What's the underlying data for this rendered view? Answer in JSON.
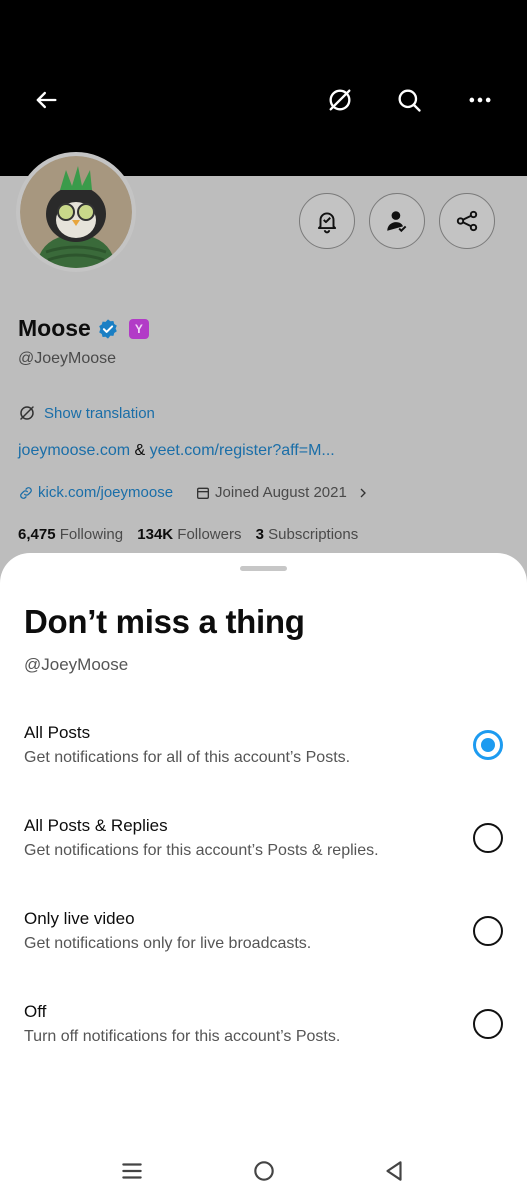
{
  "header": {
    "back_icon": "arrow-left-icon",
    "translate_icon": "translate-off-icon",
    "search_icon": "search-icon",
    "more_icon": "more-dots-icon"
  },
  "profile": {
    "name": "Moose",
    "badge_letter": "Y",
    "handle": "@JoeyMoose",
    "show_translation": "Show translation",
    "link1": "joeymoose.com",
    "link_sep": " & ",
    "link2": "yeet.com/register?aff=M...",
    "website": "kick.com/joeymoose",
    "joined": "Joined August 2021",
    "following_count": "6,475",
    "following_label": "Following",
    "followers_count": "134K",
    "followers_label": "Followers",
    "subs_count": "3",
    "subs_label": "Subscriptions"
  },
  "sheet": {
    "title": "Don’t miss a thing",
    "handle": "@JoeyMoose",
    "options": [
      {
        "title": "All Posts",
        "desc": "Get notifications for all of this account’s Posts.",
        "selected": true
      },
      {
        "title": "All Posts & Replies",
        "desc": "Get notifications for this account’s Posts & replies.",
        "selected": false
      },
      {
        "title": "Only live video",
        "desc": "Get notifications only for live broadcasts.",
        "selected": false
      },
      {
        "title": "Off",
        "desc": "Turn off notifications for this account’s Posts.",
        "selected": false
      }
    ]
  },
  "colors": {
    "accent": "#1d9bf0",
    "link": "#1a6ea8",
    "dim_overlay": "#bdbdbd"
  }
}
